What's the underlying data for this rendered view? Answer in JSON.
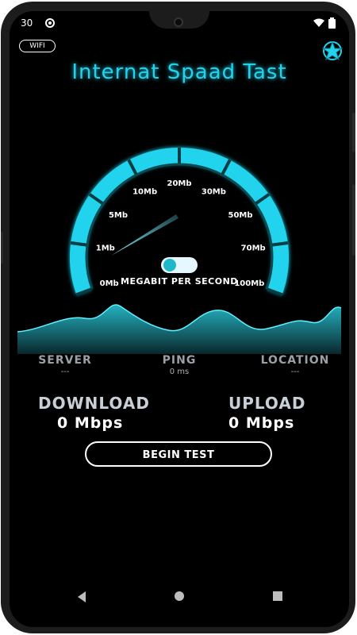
{
  "status_bar": {
    "time": "30",
    "icons": [
      "sync-icon",
      "wifi-icon",
      "battery-icon"
    ]
  },
  "header": {
    "wifi_badge": "WIFI",
    "title": "Internat Spaad Tast"
  },
  "gauge": {
    "ticks": [
      "0Mb",
      "1Mb",
      "5Mb",
      "10Mb",
      "20Mb",
      "30Mb",
      "50Mb",
      "70Mb",
      "100Mb"
    ],
    "needle_value_label": "0Mb",
    "unit_caption": "MEGABIT PER SECOND",
    "accent_color": "#22d3ee"
  },
  "stats": {
    "server": {
      "label": "SERVER",
      "value": "---"
    },
    "ping": {
      "label": "PING",
      "value": "0 ms"
    },
    "location": {
      "label": "LOCATION",
      "value": "---"
    }
  },
  "results": {
    "download": {
      "label": "DOWNLOAD",
      "value": "0",
      "unit": "Mbps"
    },
    "upload": {
      "label": "UPLOAD",
      "value": "0",
      "unit": "Mbps"
    }
  },
  "actions": {
    "begin": "BEGIN TEST"
  },
  "nav_bar": [
    "back-icon",
    "home-icon",
    "recents-icon"
  ]
}
